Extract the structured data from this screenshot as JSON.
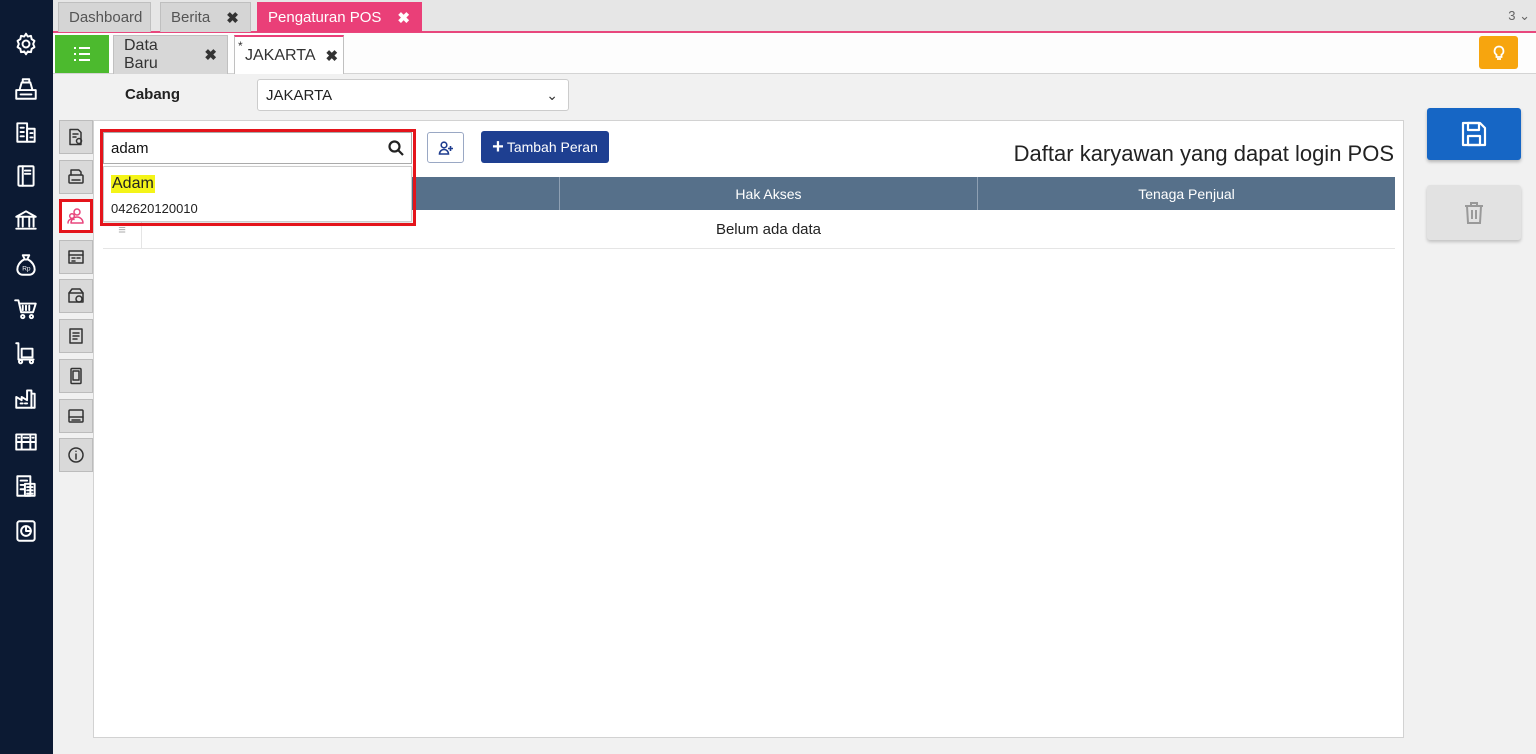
{
  "top_tabs": [
    {
      "label": "Dashboard",
      "closable": false
    },
    {
      "label": "Berita",
      "closable": true
    },
    {
      "label": "Pengaturan POS",
      "closable": true,
      "active": true
    }
  ],
  "tab_counter": "3 ⌄",
  "sub_tabs": [
    {
      "label": "Data Baru",
      "closable": true
    },
    {
      "label": "JAKARTA",
      "closable": true,
      "active": true,
      "dirty_mark": "*"
    }
  ],
  "close_glyph": "✖",
  "branch": {
    "label": "Cabang",
    "value": "JAKARTA",
    "chevron": "⌄"
  },
  "search": {
    "value": "adam"
  },
  "suggestion": {
    "name": "Adam",
    "code": "042620120010"
  },
  "add_role_button": {
    "icon": "+",
    "label": "Tambah Peran"
  },
  "panel_title": "Daftar karyawan yang dapat login POS",
  "table": {
    "columns": [
      "",
      "Hak Akses",
      "Tenaga Penjual"
    ],
    "empty_text": "Belum ada data",
    "drag_glyph": "≡"
  },
  "colors": {
    "sidebar": "#0c1a33",
    "active_tab": "#ea3f78",
    "menu_button": "#4cba2e",
    "hint_button": "#f7a50e",
    "primary": "#1e3f91",
    "save": "#1666c5",
    "table_header": "#56708a",
    "highlight_frame": "#e4141b",
    "search_highlight": "#f4f418"
  },
  "sidebar_icons": [
    "gear-icon",
    "cashier-icon",
    "building-icon",
    "book-icon",
    "bank-icon",
    "money-bag-icon",
    "cart-icon",
    "delivery-icon",
    "factory-icon",
    "warehouse-icon",
    "tax-icon",
    "chart-icon"
  ],
  "side_tab_icons": [
    "document-settings-icon",
    "printer-icon",
    "users-icon",
    "card-icon",
    "calendar-box-icon",
    "receipt-icon",
    "tablet-icon",
    "terminal-icon",
    "info-icon"
  ]
}
